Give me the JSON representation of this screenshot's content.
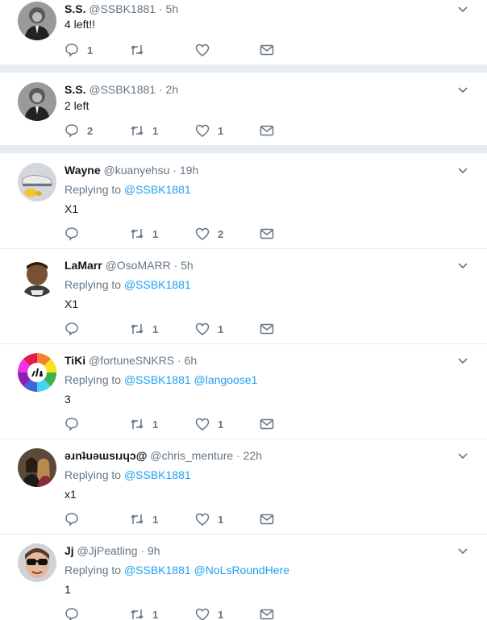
{
  "tweets": [
    {
      "name": "S.S.",
      "handle": "@SSBK1881",
      "dot": "·",
      "time": "5h",
      "replying_label": "",
      "mentions": [],
      "text": "4 left!!",
      "replies": "1",
      "retweets": "",
      "likes": "",
      "avatar": "monkey-suit"
    },
    {
      "name": "S.S.",
      "handle": "@SSBK1881",
      "dot": "·",
      "time": "2h",
      "replying_label": "",
      "mentions": [],
      "text": "2 left",
      "replies": "2",
      "retweets": "1",
      "likes": "1",
      "avatar": "monkey-suit"
    },
    {
      "name": "Wayne",
      "handle": "@kuanyehsu",
      "dot": "·",
      "time": "19h",
      "replying_label": "Replying to",
      "mentions": [
        "@SSBK1881"
      ],
      "text": "X1",
      "replies": "",
      "retweets": "1",
      "likes": "2",
      "avatar": "sneaker"
    },
    {
      "name": "LaMarr",
      "handle": "@OsoMARR",
      "dot": "·",
      "time": "5h",
      "replying_label": "Replying to",
      "mentions": [
        "@SSBK1881"
      ],
      "text": "X1",
      "replies": "",
      "retweets": "1",
      "likes": "1",
      "avatar": "face"
    },
    {
      "name": "TiKi",
      "handle": "@fortuneSNKRS",
      "dot": "·",
      "time": "6h",
      "replying_label": "Replying to",
      "mentions": [
        "@SSBK1881",
        "@langoose1"
      ],
      "text": "3",
      "replies": "",
      "retweets": "1",
      "likes": "1",
      "avatar": "wheel"
    },
    {
      "name": "ǝɹnʇuǝɯsıɹɥɔ@",
      "handle": "@chris_menture",
      "dot": "·",
      "time": "22h",
      "replying_label": "Replying to",
      "mentions": [
        "@SSBK1881"
      ],
      "text": "x1",
      "replies": "",
      "retweets": "1",
      "likes": "1",
      "avatar": "couple"
    },
    {
      "name": "Jj",
      "handle": "@JjPeatling",
      "dot": "·",
      "time": "9h",
      "replying_label": "Replying to",
      "mentions": [
        "@SSBK1881",
        "@NoLsRoundHere"
      ],
      "text": "1",
      "replies": "",
      "retweets": "1",
      "likes": "1",
      "avatar": "sunglasses"
    }
  ],
  "colors": {
    "accent": "#1da1f2",
    "muted": "#657786",
    "text": "#14171a",
    "separator": "#e6ecf0"
  }
}
